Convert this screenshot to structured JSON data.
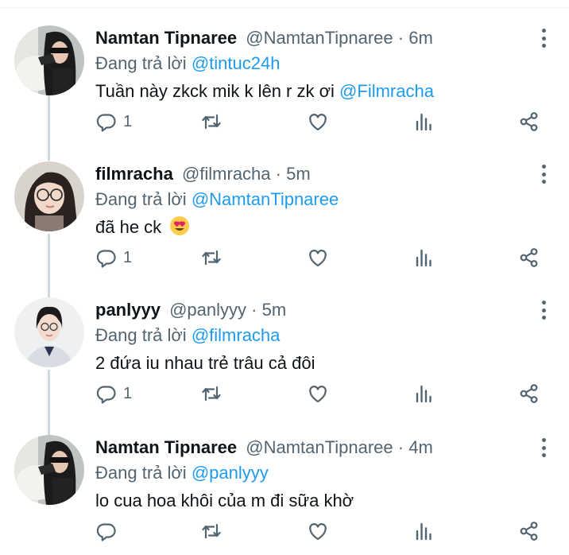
{
  "tweets": [
    {
      "name": "Namtan Tipnaree",
      "handle": "@NamtanTipnaree",
      "separator": "·",
      "time": "6m",
      "reply_prefix": "Đang trả lời",
      "reply_to": "@tintuc24h",
      "text": "Tuần này zkck mik k lên r zk ơi",
      "text_mention": "@Filmracha",
      "reply_count": "1",
      "avatar": "namtan-avatar"
    },
    {
      "name": "filmracha",
      "handle": "@filmracha",
      "separator": "·",
      "time": "5m",
      "reply_prefix": "Đang trả lời",
      "reply_to": "@NamtanTipnaree",
      "text": "đã he ck",
      "emoji": "heart-eyes-emoji",
      "reply_count": "1",
      "avatar": "filmracha-avatar"
    },
    {
      "name": "panlyyy",
      "handle": "@panlyyy",
      "separator": "·",
      "time": "5m",
      "reply_prefix": "Đang trả lời",
      "reply_to": "@filmracha",
      "text": "2 đứa iu nhau trẻ trâu cả đôi",
      "reply_count": "1",
      "avatar": "panlyyy-avatar"
    },
    {
      "name": "Namtan Tipnaree",
      "handle": "@NamtanTipnaree",
      "separator": "·",
      "time": "4m",
      "reply_prefix": "Đang trả lời",
      "reply_to": "@panlyyy",
      "text": "lo cua hoa khôi của m đi sữa khờ",
      "reply_count": "",
      "avatar": "namtan-avatar"
    }
  ],
  "icons": {
    "reply": "reply-icon",
    "retweet": "retweet-icon",
    "like": "heart-icon",
    "views": "views-icon",
    "share": "share-icon",
    "more": "more-vertical-icon"
  },
  "colors": {
    "text": "#0f1419",
    "secondary": "#536471",
    "link": "#1d9bf0",
    "thread_line": "#cfd9de"
  }
}
